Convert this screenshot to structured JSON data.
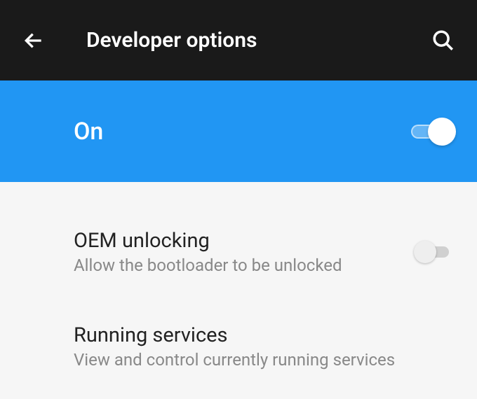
{
  "header": {
    "title": "Developer options"
  },
  "master_toggle": {
    "label": "On",
    "state": "on"
  },
  "settings": {
    "oem_unlocking": {
      "title": "OEM unlocking",
      "subtitle": "Allow the bootloader to be unlocked",
      "state": "off"
    },
    "running_services": {
      "title": "Running services",
      "subtitle": "View and control currently running services"
    }
  }
}
